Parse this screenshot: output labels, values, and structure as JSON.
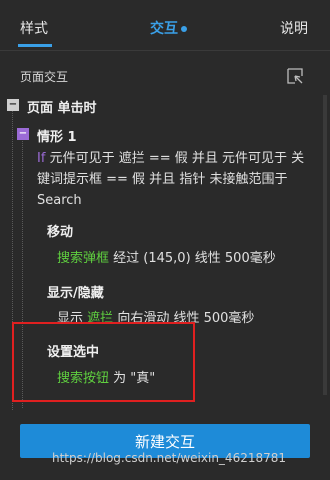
{
  "tabs": [
    {
      "label": "样式"
    },
    {
      "label": "交互"
    },
    {
      "label": "说明"
    }
  ],
  "panel_title": "页面交互",
  "event": {
    "label": "页面 单击时"
  },
  "case": {
    "label": "情形 1",
    "condition_keyword": "If",
    "condition_text": "元件可见于 遮拦 == 假 并且 元件可见于 关键词提示框 == 假 并且 指针 未接触范围于 Search"
  },
  "actions": [
    {
      "title": "移动",
      "target": "搜索弹框",
      "detail": "经过 (145,0) 线性 500毫秒"
    },
    {
      "title": "显示/隐藏",
      "verb": "显示",
      "target": "遮拦",
      "detail": "向右滑动 线性 500毫秒"
    },
    {
      "title": "设置选中",
      "target": "搜索按钮",
      "detail": "为 \"真\""
    }
  ],
  "new_button": {
    "label": "新建交互"
  },
  "watermark": "https://blog.csdn.net/weixin_46218781",
  "colors": {
    "accent": "#3aa0e8",
    "target_green": "#5fcf3f",
    "highlight_red": "#e02020"
  }
}
